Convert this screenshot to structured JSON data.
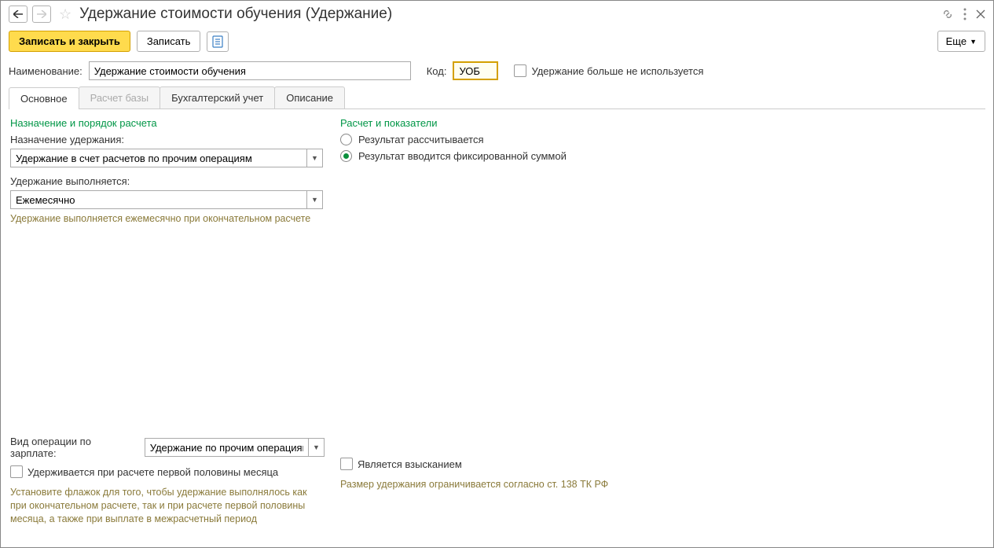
{
  "title": "Удержание стоимости обучения (Удержание)",
  "toolbar": {
    "save_close": "Записать и закрыть",
    "save": "Записать",
    "more": "Еще"
  },
  "form": {
    "name_label": "Наименование:",
    "name_value": "Удержание стоимости обучения",
    "code_label": "Код:",
    "code_value": "УОБ",
    "not_used_label": "Удержание больше не используется"
  },
  "tabs": {
    "main": "Основное",
    "base": "Расчет базы",
    "accounting": "Бухгалтерский учет",
    "description": "Описание"
  },
  "left": {
    "section": "Назначение и порядок расчета",
    "purpose_label": "Назначение удержания:",
    "purpose_value": "Удержание в счет расчетов по прочим операциям",
    "executed_label": "Удержание выполняется:",
    "executed_value": "Ежемесячно",
    "executed_hint": "Удержание выполняется ежемесячно при окончательном расчете"
  },
  "right": {
    "section": "Расчет и показатели",
    "radio_calc": "Результат рассчитывается",
    "radio_fixed": "Результат вводится фиксированной суммой"
  },
  "bottom": {
    "op_label": "Вид операции по зарплате:",
    "op_value": "Удержание по прочим операциям",
    "first_half_label": "Удерживается при расчете первой половины месяца",
    "first_half_hint": "Установите флажок для того, чтобы удержание выполнялось как при окончательном расчете, так и при расчете первой половины месяца, а также при выплате в межрасчетный период",
    "is_collection_label": "Является взысканием",
    "is_collection_hint": "Размер удержания ограничивается согласно ст. 138 ТК РФ"
  }
}
